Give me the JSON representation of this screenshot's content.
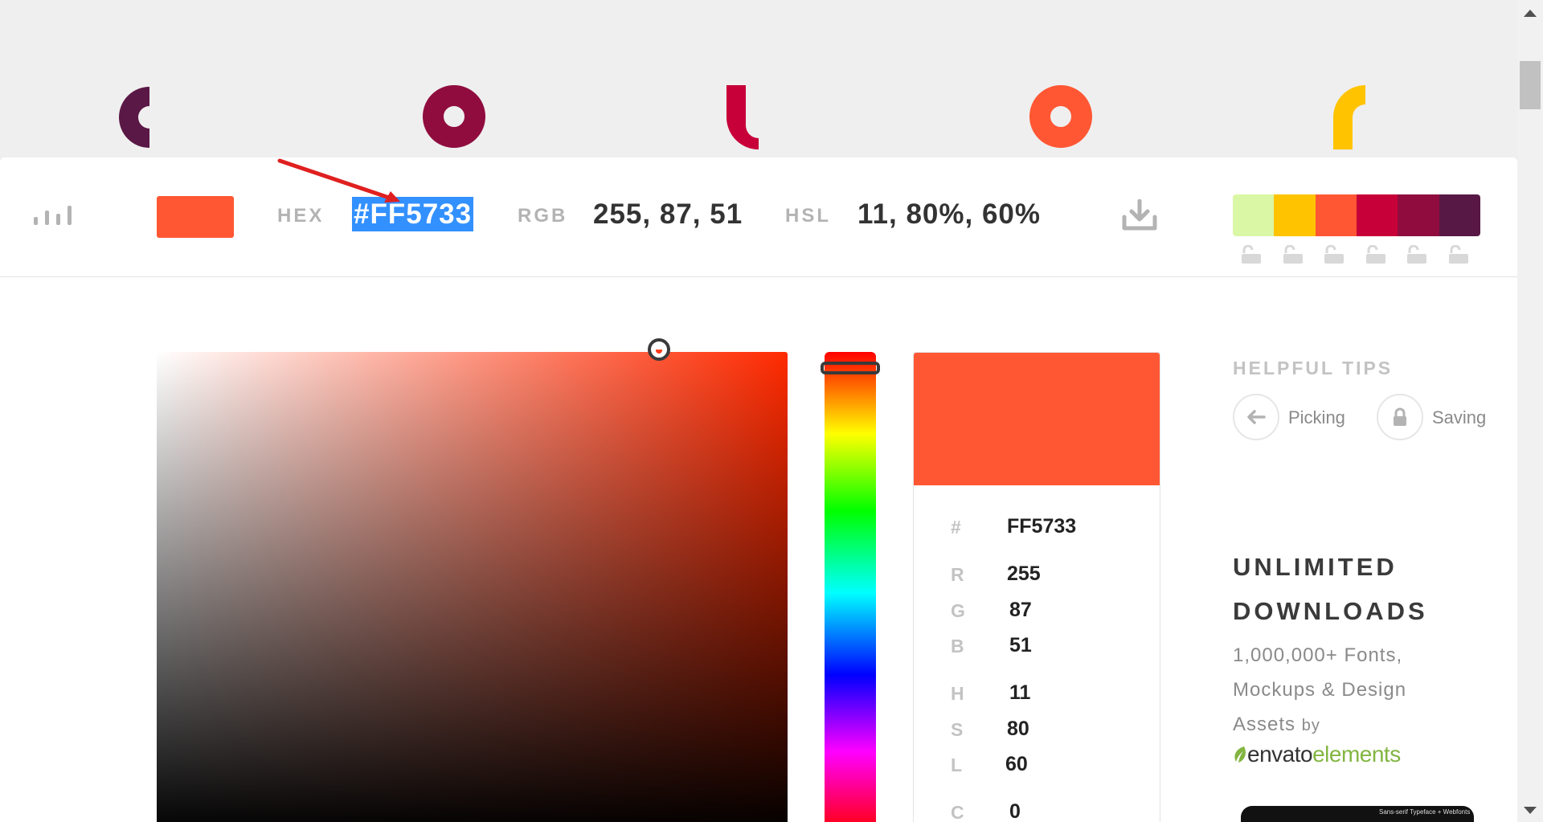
{
  "logo": {
    "letters": [
      "c",
      "o",
      "l",
      "o",
      "r"
    ],
    "colors": [
      "#5a1846",
      "#900c3e",
      "#c70039",
      "#ff5733",
      "#ffc300"
    ]
  },
  "header": {
    "chart_icon": "bar-chart-icon",
    "swatch_color": "#ff5733",
    "hex_label": "HEX",
    "hex_value": "#FF5733",
    "rgb_label": "RGB",
    "rgb_value": "255, 87, 51",
    "hsl_label": "HSL",
    "hsl_value": "11, 80%, 60%",
    "download_icon": "download-icon",
    "palette": [
      "#daf7a6",
      "#ffc300",
      "#ff5733",
      "#c70039",
      "#900c3e",
      "#571845"
    ],
    "lock_icon": "unlock-icon"
  },
  "picker": {
    "hue_color": "#ff2a00",
    "preview_color": "#ff5733"
  },
  "specs": [
    {
      "key": "#",
      "value": "FF5733"
    },
    {
      "key": "R",
      "value": "255"
    },
    {
      "key": "G",
      "value": "87"
    },
    {
      "key": "B",
      "value": "51"
    },
    {
      "key": "H",
      "value": "11"
    },
    {
      "key": "S",
      "value": "80"
    },
    {
      "key": "L",
      "value": "60"
    },
    {
      "key": "C",
      "value": "0"
    }
  ],
  "tips": {
    "title": "HELPFUL TIPS",
    "items": [
      {
        "label": "Picking",
        "icon": "arrow-left-icon"
      },
      {
        "label": "Saving",
        "icon": "lock-icon"
      }
    ]
  },
  "ad": {
    "title_line1": "UNLIMITED",
    "title_line2": "DOWNLOADS",
    "text": "1,000,000+ Fonts, Mockups & Design Assets",
    "by": "by",
    "brand_main": "envato",
    "brand_accent": "elements",
    "thumb_caption": "Sans-serif Typeface + Webfonts"
  }
}
